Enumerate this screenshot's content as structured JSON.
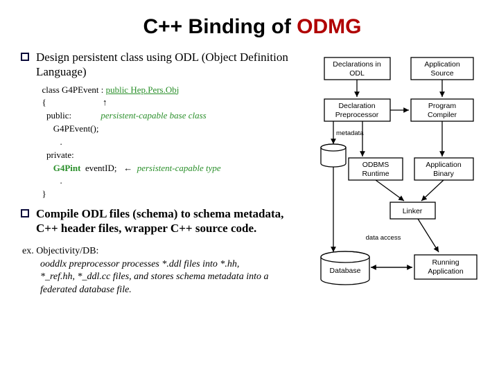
{
  "title_prefix": "C++ Binding of ",
  "title_accent": "ODMG",
  "bullets": [
    "Design persistent class using ODL (Object Definition Language)",
    "Compile ODL files (schema) to schema metadata, C++ header files, wrapper C++ source code."
  ],
  "code": {
    "l0a": "  class G4PEvent : ",
    "l0b": "public Hep.Pers.Obj",
    "l1a": "  {",
    "l1arrow": "                         ↑",
    "l2a": "    public:",
    "l2b": "             persistent-capable base class",
    "l3": "       G4PEvent();",
    "l4": "          .",
    "l5": "    private:",
    "l6a": "       ",
    "l6b": "G4Pint",
    "l6c": "  eventID;   ",
    "l6arrow": "←  ",
    "l6d": "persistent-capable type",
    "l7": "          .",
    "l8": "  }"
  },
  "example": {
    "label": "ex. Objectivity/DB:",
    "body": "ooddlx preprocessor processes *.ddl files into *.hh, *_ref.hh, *_ddl.cc files, and stores schema metadata into a federated database file."
  },
  "diagram": {
    "declarations": "Declarations in\nODL",
    "appsource": "Application\nSource",
    "preproc": "Declaration\nPreprocessor",
    "progcomp": "Program\nCompiler",
    "metadata": "metadata",
    "runtime": "ODBMS\nRuntime",
    "appbinary": "Application\nBinary",
    "linker": "Linker",
    "dataaccess": "data access",
    "database": "Database",
    "runapp": "Running\nApplication"
  }
}
